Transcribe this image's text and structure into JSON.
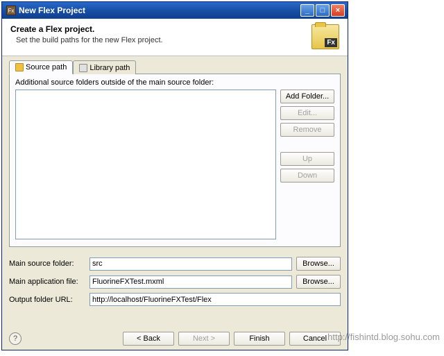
{
  "window": {
    "title": "New Flex Project"
  },
  "header": {
    "title": "Create a Flex project.",
    "subtitle": "Set the build paths for the new Flex project.",
    "icon_badge": "Fx"
  },
  "tabs": {
    "source": "Source path",
    "library": "Library path"
  },
  "source_panel": {
    "label": "Additional source folders outside of the main source folder:",
    "buttons": {
      "add": "Add Folder...",
      "edit": "Edit...",
      "remove": "Remove",
      "up": "Up",
      "down": "Down"
    }
  },
  "form": {
    "main_source_label": "Main source folder:",
    "main_source_value": "src",
    "main_app_label": "Main application file:",
    "main_app_value": "FluorineFXTest.mxml",
    "output_url_label": "Output folder URL:",
    "output_url_value": "http://localhost/FluorineFXTest/Flex",
    "browse": "Browse..."
  },
  "footer": {
    "back": "< Back",
    "next": "Next >",
    "finish": "Finish",
    "cancel": "Cancel"
  },
  "watermark": "http://fishintd.blog.sohu.com"
}
